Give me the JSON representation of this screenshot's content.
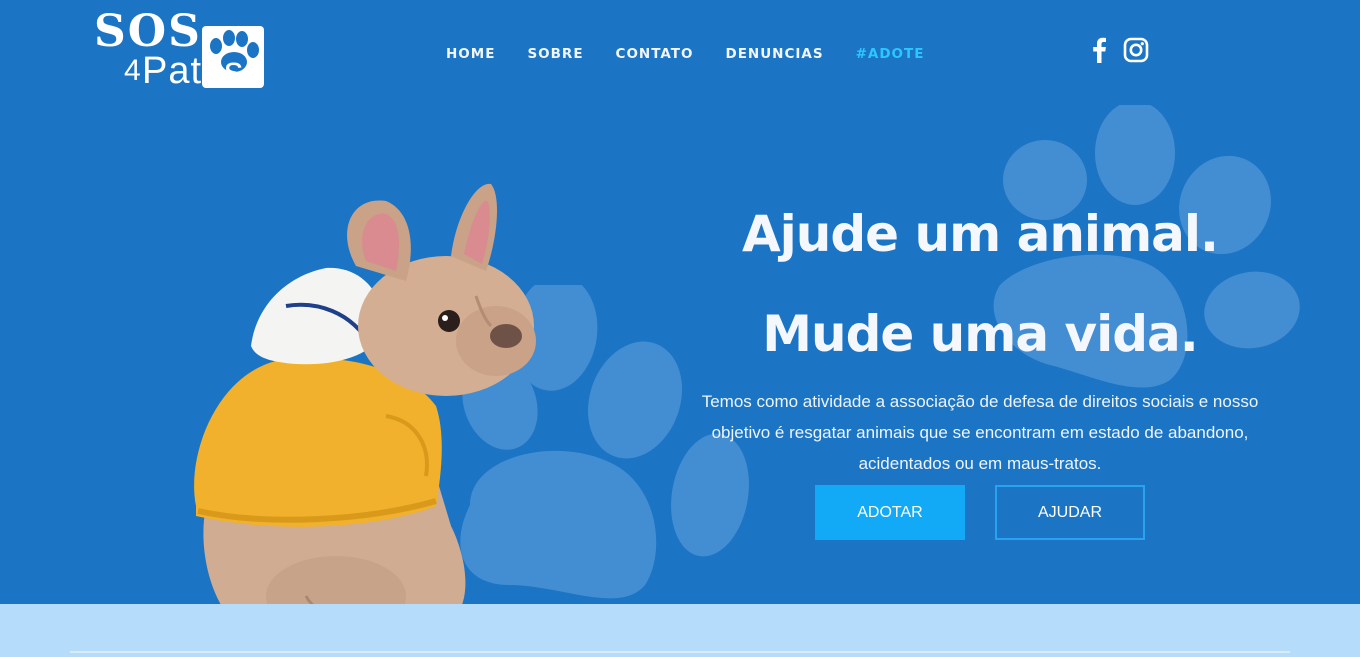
{
  "brand": {
    "logo_line1": "SOS",
    "logo_line2_prefix": "4",
    "logo_line2": "Patas"
  },
  "nav": {
    "items": [
      {
        "label": "HOME"
      },
      {
        "label": "SOBRE"
      },
      {
        "label": "CONTATO"
      },
      {
        "label": "DENUNCIAS"
      },
      {
        "label": "#ADOTE",
        "active": true
      }
    ]
  },
  "social": {
    "facebook_icon": "facebook-icon",
    "instagram_icon": "instagram-icon"
  },
  "hero": {
    "headline_1": "Ajude um animal.",
    "headline_2": "Mude uma vida.",
    "description": "Temos como atividade a associação de defesa de direitos sociais e nosso objetivo é resgatar animais que se encontram em estado de abandono, acidentados ou em maus-tratos.",
    "buttons": {
      "primary": "ADOTAR",
      "secondary": "AJUDAR"
    }
  },
  "colors": {
    "background": "#1b75c4",
    "accent": "#12a9f6",
    "active_nav": "#2dc7ff",
    "bottom_band": "#b6dcfb"
  }
}
